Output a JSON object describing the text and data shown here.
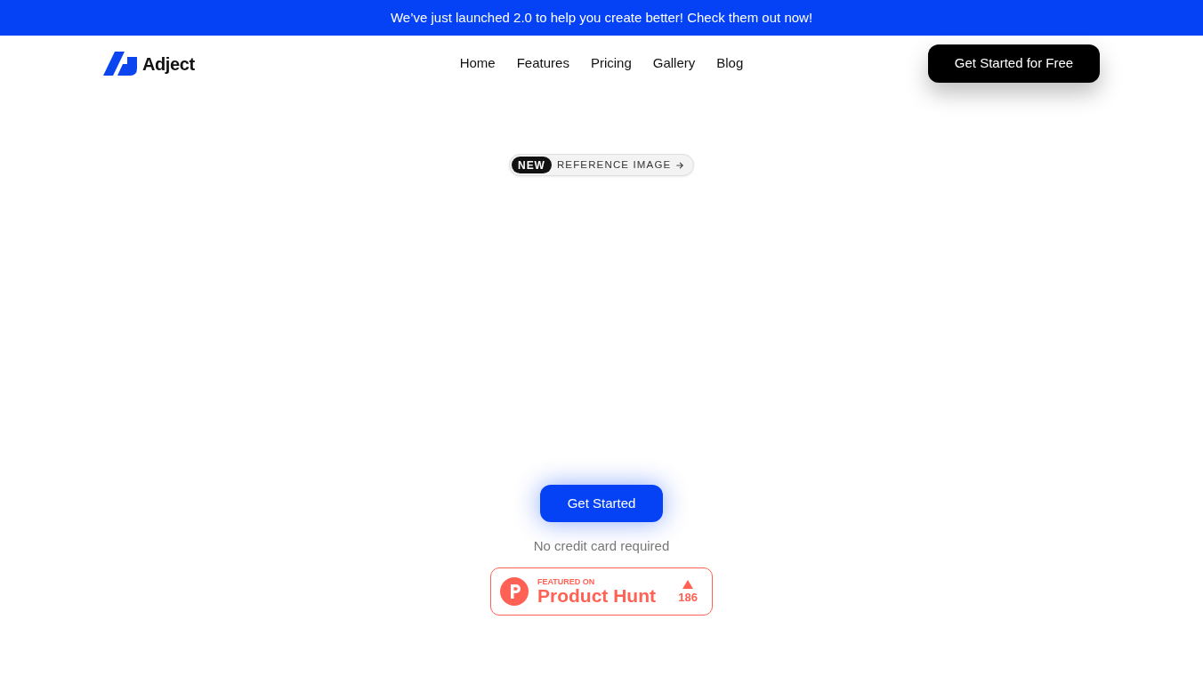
{
  "announcement": {
    "text": "We’ve just launched 2.0 to help you create better! Check them out now!"
  },
  "nav": {
    "brand": "Adject",
    "links": [
      "Home",
      "Features",
      "Pricing",
      "Gallery",
      "Blog"
    ],
    "cta": "Get Started for Free"
  },
  "hero": {
    "pill": {
      "badge": "NEW",
      "label": "REFERENCE IMAGE"
    },
    "cta": "Get Started",
    "note": "No credit card required",
    "product_hunt": {
      "featured": "FEATURED ON",
      "name": "Product Hunt",
      "votes": "186"
    }
  }
}
